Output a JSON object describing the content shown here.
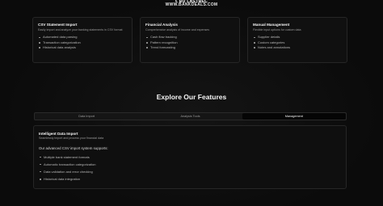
{
  "banner": {
    "line1": "€ 𝐁𝐔 𝐋𝐀𝐒𝐓𝐁𝐄𝐂",
    "line2": "WWW.BANKDEALS.COM"
  },
  "feature_cards": [
    {
      "title": "CSV Statement Import",
      "description": "Easily import and analyze your banking statements in CSV format",
      "items": [
        "Automated data parsing",
        "Transaction categorization",
        "Historical data analysis"
      ]
    },
    {
      "title": "Financial Analysis",
      "description": "Comprehensive analysis of income and expenses",
      "items": [
        "Cash flow tracking",
        "Pattern recognition",
        "Trend forecasting"
      ]
    },
    {
      "title": "Manual Management",
      "description": "Flexible input options for custom data",
      "items": [
        "Supplier details",
        "Custom categories",
        "Notes and annotations"
      ]
    }
  ],
  "section": {
    "title": "Explore Our Features"
  },
  "tabs": [
    {
      "label": "Data Import",
      "active": false
    },
    {
      "label": "Analysis Tools",
      "active": false
    },
    {
      "label": "Management",
      "active": true
    }
  ],
  "panel": {
    "title": "Intelligent Data Import",
    "description": "Seamlessly import and process your financial data",
    "intro": "Our advanced CSV import system supports:",
    "items": [
      "Multiple bank statement formats",
      "Automatic transaction categorization",
      "Data validation and error checking",
      "Historical data integration"
    ]
  }
}
